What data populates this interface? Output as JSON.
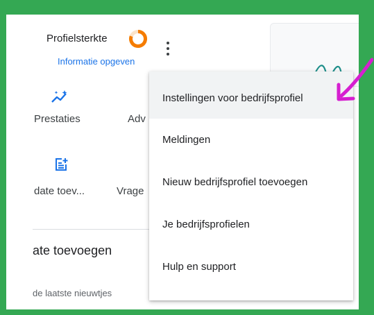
{
  "profile": {
    "strength_label": "Profielsterkte",
    "info_link": "Informatie opgeven"
  },
  "actions": [
    {
      "label": "Prestaties",
      "icon": "sparkle-chart-icon"
    },
    {
      "label": "Adv"
    },
    {
      "label": "date toev...",
      "icon": "post-add-icon"
    },
    {
      "label": "Vrage"
    }
  ],
  "section": {
    "title": "ate toevoegen",
    "subtitle": "de laatste nieuwtjes"
  },
  "menu": {
    "items": [
      "Instellingen voor bedrijfsprofiel",
      "Meldingen",
      "Nieuw bedrijfsprofiel toevoegen",
      "Je bedrijfsprofielen",
      "Hulp en support"
    ]
  },
  "colors": {
    "background_green": "#34a853",
    "ring_orange": "#f57c00",
    "link_blue": "#1a73e8",
    "arrow_magenta": "#d61fd0"
  }
}
